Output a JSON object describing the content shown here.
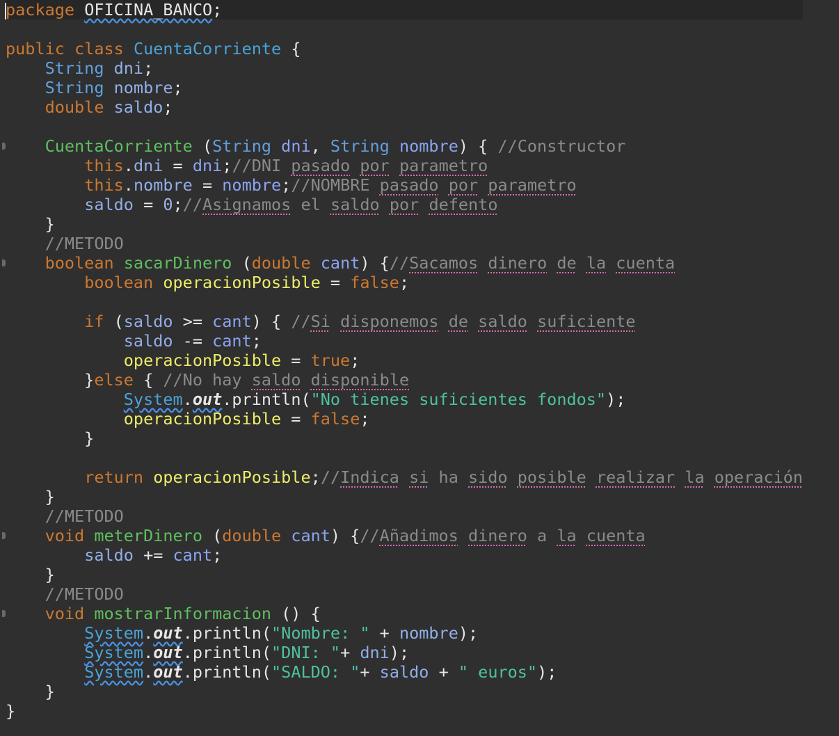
{
  "editor": {
    "lines": [
      [
        [
          "pkg-kw",
          "package"
        ],
        [
          "plain",
          " "
        ],
        [
          "pkg-name",
          "OFICINA_BANCO"
        ],
        [
          "plain",
          ";"
        ]
      ],
      [],
      [
        [
          "kw",
          "public"
        ],
        [
          "plain",
          " "
        ],
        [
          "kw",
          "class"
        ],
        [
          "plain",
          " "
        ],
        [
          "cls",
          "CuentaCorriente"
        ],
        [
          "plain",
          " {"
        ]
      ],
      [
        [
          "plain",
          "    "
        ],
        [
          "type",
          "String"
        ],
        [
          "plain",
          " "
        ],
        [
          "field",
          "dni"
        ],
        [
          "plain",
          ";"
        ]
      ],
      [
        [
          "plain",
          "    "
        ],
        [
          "type",
          "String"
        ],
        [
          "plain",
          " "
        ],
        [
          "field",
          "nombre"
        ],
        [
          "plain",
          ";"
        ]
      ],
      [
        [
          "plain",
          "    "
        ],
        [
          "kw",
          "double"
        ],
        [
          "plain",
          " "
        ],
        [
          "field",
          "saldo"
        ],
        [
          "plain",
          ";"
        ]
      ],
      [],
      [
        [
          "plain",
          "    "
        ],
        [
          "meth",
          "CuentaCorriente"
        ],
        [
          "plain",
          " ("
        ],
        [
          "type",
          "String"
        ],
        [
          "plain",
          " "
        ],
        [
          "param",
          "dni"
        ],
        [
          "plain",
          ", "
        ],
        [
          "type",
          "String"
        ],
        [
          "plain",
          " "
        ],
        [
          "param",
          "nombre"
        ],
        [
          "plain",
          ") { "
        ],
        [
          "com",
          "//Constructor"
        ]
      ],
      [
        [
          "plain",
          "        "
        ],
        [
          "kw",
          "this"
        ],
        [
          "plain",
          "."
        ],
        [
          "field",
          "dni"
        ],
        [
          "plain",
          " = "
        ],
        [
          "param",
          "dni"
        ],
        [
          "plain",
          ";"
        ],
        [
          "com",
          "//DNI "
        ],
        [
          "com-sq",
          "pasado"
        ],
        [
          "com",
          " "
        ],
        [
          "com-sq",
          "por"
        ],
        [
          "com",
          " "
        ],
        [
          "com-sq",
          "parametro"
        ]
      ],
      [
        [
          "plain",
          "        "
        ],
        [
          "kw",
          "this"
        ],
        [
          "plain",
          "."
        ],
        [
          "field",
          "nombre"
        ],
        [
          "plain",
          " = "
        ],
        [
          "param",
          "nombre"
        ],
        [
          "plain",
          ";"
        ],
        [
          "com",
          "//NOMBRE "
        ],
        [
          "com-sq",
          "pasado"
        ],
        [
          "com",
          " "
        ],
        [
          "com-sq",
          "por"
        ],
        [
          "com",
          " "
        ],
        [
          "com-sq",
          "parametro"
        ]
      ],
      [
        [
          "plain",
          "        "
        ],
        [
          "field",
          "saldo"
        ],
        [
          "plain",
          " = "
        ],
        [
          "num",
          "0"
        ],
        [
          "plain",
          ";"
        ],
        [
          "com",
          "//"
        ],
        [
          "com-sq",
          "Asignamos"
        ],
        [
          "com",
          " el "
        ],
        [
          "com-sq",
          "saldo"
        ],
        [
          "com",
          " "
        ],
        [
          "com-sq",
          "por"
        ],
        [
          "com",
          " "
        ],
        [
          "com-sq",
          "defento"
        ]
      ],
      [
        [
          "plain",
          "    }"
        ]
      ],
      [
        [
          "plain",
          "    "
        ],
        [
          "com",
          "//METODO"
        ]
      ],
      [
        [
          "plain",
          "    "
        ],
        [
          "kw",
          "boolean"
        ],
        [
          "plain",
          " "
        ],
        [
          "meth",
          "sacarDinero"
        ],
        [
          "plain",
          " ("
        ],
        [
          "kw",
          "double"
        ],
        [
          "plain",
          " "
        ],
        [
          "param",
          "cant"
        ],
        [
          "plain",
          ") {"
        ],
        [
          "com",
          "//"
        ],
        [
          "com-sq",
          "Sacamos"
        ],
        [
          "com",
          " "
        ],
        [
          "com-sq",
          "dinero"
        ],
        [
          "com",
          " "
        ],
        [
          "com-sq",
          "de"
        ],
        [
          "com",
          " "
        ],
        [
          "com-sq",
          "la"
        ],
        [
          "com",
          " "
        ],
        [
          "com-sq",
          "cuenta"
        ]
      ],
      [
        [
          "plain",
          "        "
        ],
        [
          "kw",
          "boolean"
        ],
        [
          "plain",
          " "
        ],
        [
          "var",
          "operacionPosible"
        ],
        [
          "plain",
          " = "
        ],
        [
          "kw",
          "false"
        ],
        [
          "plain",
          ";"
        ]
      ],
      [],
      [
        [
          "plain",
          "        "
        ],
        [
          "kw",
          "if"
        ],
        [
          "plain",
          " ("
        ],
        [
          "field",
          "saldo"
        ],
        [
          "plain",
          " >= "
        ],
        [
          "param",
          "cant"
        ],
        [
          "plain",
          ") { "
        ],
        [
          "com",
          "//"
        ],
        [
          "com-sq",
          "Si"
        ],
        [
          "com",
          " "
        ],
        [
          "com-sq",
          "disponemos"
        ],
        [
          "com",
          " "
        ],
        [
          "com-sq",
          "de"
        ],
        [
          "com",
          " "
        ],
        [
          "com-sq",
          "saldo"
        ],
        [
          "com",
          " "
        ],
        [
          "com-sq",
          "suficiente"
        ]
      ],
      [
        [
          "plain",
          "            "
        ],
        [
          "field",
          "saldo"
        ],
        [
          "plain",
          " -= "
        ],
        [
          "param",
          "cant"
        ],
        [
          "plain",
          ";"
        ]
      ],
      [
        [
          "plain",
          "            "
        ],
        [
          "var",
          "operacionPosible"
        ],
        [
          "plain",
          " = "
        ],
        [
          "kw",
          "true"
        ],
        [
          "plain",
          ";"
        ]
      ],
      [
        [
          "plain",
          "        }"
        ],
        [
          "kw",
          "else"
        ],
        [
          "plain",
          " { "
        ],
        [
          "com",
          "//No hay "
        ],
        [
          "com-sq",
          "saldo"
        ],
        [
          "com",
          " "
        ],
        [
          "com-sq",
          "disponible"
        ]
      ],
      [
        [
          "plain",
          "            "
        ],
        [
          "sys",
          "System"
        ],
        [
          "plain",
          "."
        ],
        [
          "out",
          "out"
        ],
        [
          "plain",
          ".println("
        ],
        [
          "str",
          "\"No tienes suficientes fondos\""
        ],
        [
          "plain",
          ");"
        ]
      ],
      [
        [
          "plain",
          "            "
        ],
        [
          "var",
          "operacionPosible"
        ],
        [
          "plain",
          " = "
        ],
        [
          "kw",
          "false"
        ],
        [
          "plain",
          ";"
        ]
      ],
      [
        [
          "plain",
          "        }"
        ]
      ],
      [],
      [
        [
          "plain",
          "        "
        ],
        [
          "kw",
          "return"
        ],
        [
          "plain",
          " "
        ],
        [
          "var",
          "operacionPosible"
        ],
        [
          "plain",
          ";"
        ],
        [
          "com",
          "//"
        ],
        [
          "com-sq",
          "Indica"
        ],
        [
          "com",
          " "
        ],
        [
          "com-sq",
          "si"
        ],
        [
          "com",
          " ha "
        ],
        [
          "com-sq",
          "sido"
        ],
        [
          "com",
          " "
        ],
        [
          "com-sq",
          "posible"
        ],
        [
          "com",
          " "
        ],
        [
          "com-sq",
          "realizar"
        ],
        [
          "com",
          " "
        ],
        [
          "com-sq",
          "la"
        ],
        [
          "com",
          " "
        ],
        [
          "com-sq",
          "operación"
        ]
      ],
      [
        [
          "plain",
          "    }"
        ]
      ],
      [
        [
          "plain",
          "    "
        ],
        [
          "com",
          "//METODO"
        ]
      ],
      [
        [
          "plain",
          "    "
        ],
        [
          "kw",
          "void"
        ],
        [
          "plain",
          " "
        ],
        [
          "meth",
          "meterDinero"
        ],
        [
          "plain",
          " ("
        ],
        [
          "kw",
          "double"
        ],
        [
          "plain",
          " "
        ],
        [
          "param",
          "cant"
        ],
        [
          "plain",
          ") {"
        ],
        [
          "com",
          "//"
        ],
        [
          "com-sq",
          "Añadimos"
        ],
        [
          "com",
          " "
        ],
        [
          "com-sq",
          "dinero"
        ],
        [
          "com",
          " a "
        ],
        [
          "com-sq",
          "la"
        ],
        [
          "com",
          " "
        ],
        [
          "com-sq",
          "cuenta"
        ]
      ],
      [
        [
          "plain",
          "        "
        ],
        [
          "field",
          "saldo"
        ],
        [
          "plain",
          " += "
        ],
        [
          "param",
          "cant"
        ],
        [
          "plain",
          ";"
        ]
      ],
      [
        [
          "plain",
          "    }"
        ]
      ],
      [
        [
          "plain",
          "    "
        ],
        [
          "com",
          "//METODO"
        ]
      ],
      [
        [
          "plain",
          "    "
        ],
        [
          "kw",
          "void"
        ],
        [
          "plain",
          " "
        ],
        [
          "meth",
          "mostrarInformacion"
        ],
        [
          "plain",
          " () {"
        ]
      ],
      [
        [
          "plain",
          "        "
        ],
        [
          "sys",
          "System"
        ],
        [
          "plain",
          "."
        ],
        [
          "out",
          "out"
        ],
        [
          "plain",
          ".println("
        ],
        [
          "str",
          "\"Nombre: \""
        ],
        [
          "plain",
          " + "
        ],
        [
          "field",
          "nombre"
        ],
        [
          "plain",
          ");"
        ]
      ],
      [
        [
          "plain",
          "        "
        ],
        [
          "sys",
          "System"
        ],
        [
          "plain",
          "."
        ],
        [
          "out",
          "out"
        ],
        [
          "plain",
          ".println("
        ],
        [
          "str",
          "\"DNI: \""
        ],
        [
          "plain",
          "+ "
        ],
        [
          "field",
          "dni"
        ],
        [
          "plain",
          ");"
        ]
      ],
      [
        [
          "plain",
          "        "
        ],
        [
          "sys",
          "System"
        ],
        [
          "plain",
          "."
        ],
        [
          "out",
          "out"
        ],
        [
          "plain",
          ".println("
        ],
        [
          "str",
          "\"SALDO: \""
        ],
        [
          "plain",
          "+ "
        ],
        [
          "field",
          "saldo"
        ],
        [
          "plain",
          " + "
        ],
        [
          "str",
          "\" euros\""
        ],
        [
          "plain",
          ");"
        ]
      ],
      [
        [
          "plain",
          "    }"
        ]
      ],
      [
        [
          "plain",
          "}"
        ]
      ]
    ]
  },
  "colors": {
    "background": "#2f2f2f",
    "keyword": "#cc7832",
    "type": "#62a0dc",
    "field": "#92aee8",
    "string": "#4ec1a0",
    "comment": "#8a8a8a",
    "method": "#5fbf60",
    "local_var": "#ecec6a"
  }
}
